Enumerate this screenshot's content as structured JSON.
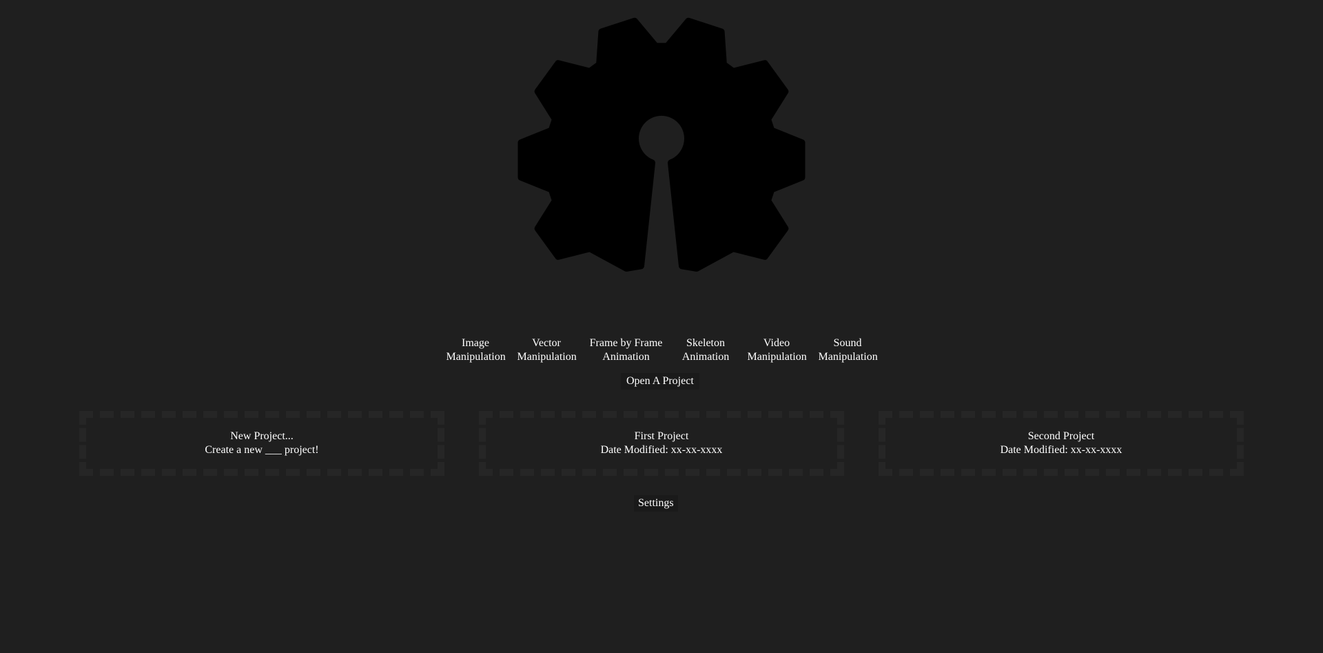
{
  "logo": {
    "icon": "gear-keyhole-logo",
    "color": "#000000"
  },
  "categories": [
    {
      "line1": "Image",
      "line2": "Manipulation"
    },
    {
      "line1": "Vector",
      "line2": "Manipulation"
    },
    {
      "line1": "Frame by Frame",
      "line2": "Animation"
    },
    {
      "line1": "Skeleton",
      "line2": "Animation"
    },
    {
      "line1": "Video",
      "line2": "Manipulation"
    },
    {
      "line1": "Sound",
      "line2": "Manipulation"
    }
  ],
  "open_project": {
    "label": "Open A Project"
  },
  "projects": [
    {
      "title": "New Project...",
      "subtitle": "Create a new ___ project!"
    },
    {
      "title": "First Project",
      "subtitle": "Date Modified: xx-xx-xxxx"
    },
    {
      "title": "Second Project",
      "subtitle": "Date Modified: xx-xx-xxxx"
    }
  ],
  "settings": {
    "label": "Settings"
  },
  "colors": {
    "background": "#1f1f1f",
    "text": "#ffffff",
    "card_border": "#262626",
    "button_bg": "#1a1a1a"
  }
}
